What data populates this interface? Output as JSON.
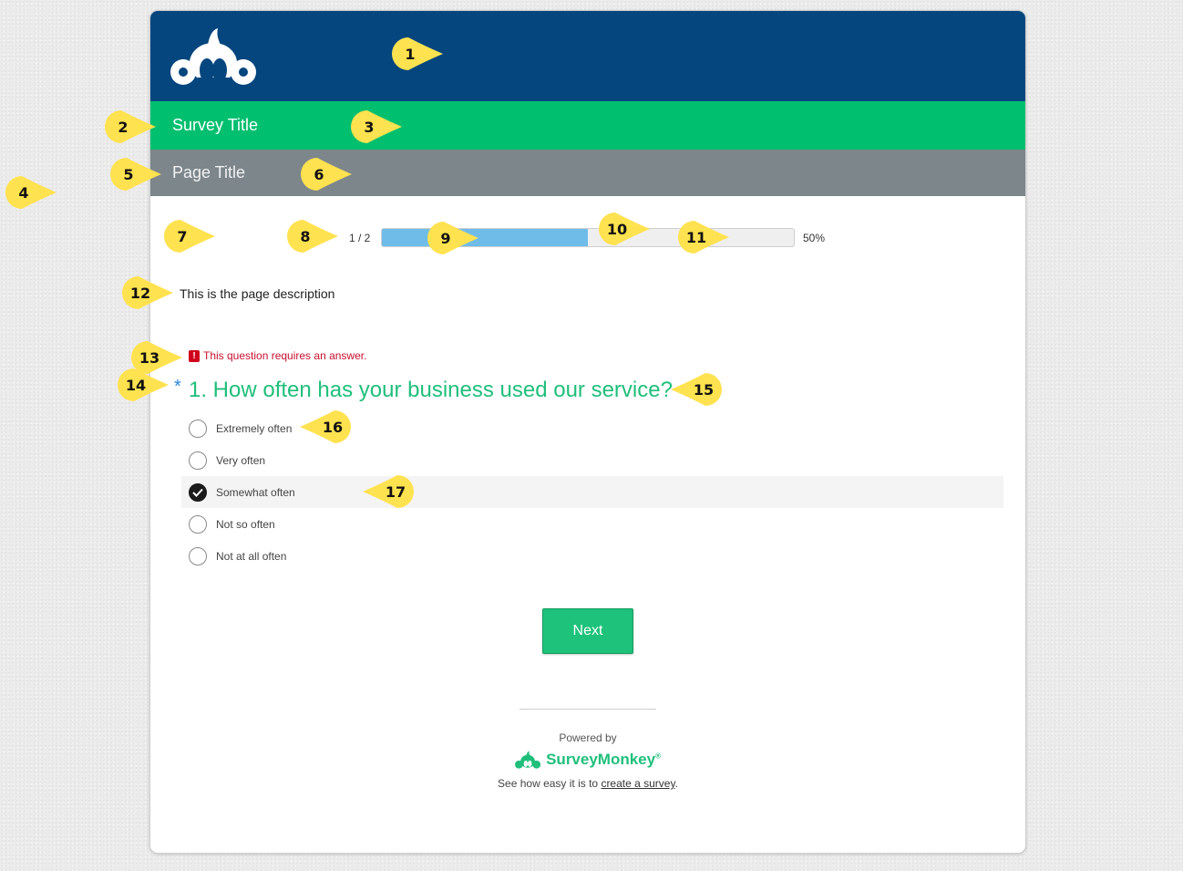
{
  "survey": {
    "title": "Survey Title",
    "page_title": "Page Title",
    "progress": {
      "text": "1 / 2",
      "fraction": 0.5,
      "percent_label": "50%"
    },
    "page_description": "This is the page description",
    "error_icon": "!",
    "error_message": "This question requires an answer.",
    "required_marker": "*",
    "question": "1. How often has your business used our service?",
    "options": [
      {
        "label": "Extremely often",
        "selected": false
      },
      {
        "label": "Very often",
        "selected": false
      },
      {
        "label": "Somewhat often",
        "selected": true
      },
      {
        "label": "Not so often",
        "selected": false
      },
      {
        "label": "Not at all often",
        "selected": false
      }
    ],
    "next_label": "Next"
  },
  "footer": {
    "powered_by": "Powered by",
    "brand": "SurveyMonkey",
    "brand_tm": "®",
    "cta_prefix": "See how easy it is to ",
    "cta_link": "create a survey",
    "cta_suffix": "."
  },
  "markers": [
    "1",
    "2",
    "3",
    "4",
    "5",
    "6",
    "7",
    "8",
    "9",
    "10",
    "11",
    "12",
    "13",
    "14",
    "15",
    "16",
    "17"
  ],
  "colors": {
    "header": "#05467e",
    "title_bar": "#00bf6f",
    "page_bar": "#7c868b",
    "progress_fill": "#6fbce9",
    "question": "#1fbf7b",
    "error": "#c8102e",
    "marker": "#ffe24f"
  },
  "icons": [
    "surveymonkey-logo-icon",
    "error-icon",
    "check-icon",
    "surveymonkey-brand-icon"
  ]
}
